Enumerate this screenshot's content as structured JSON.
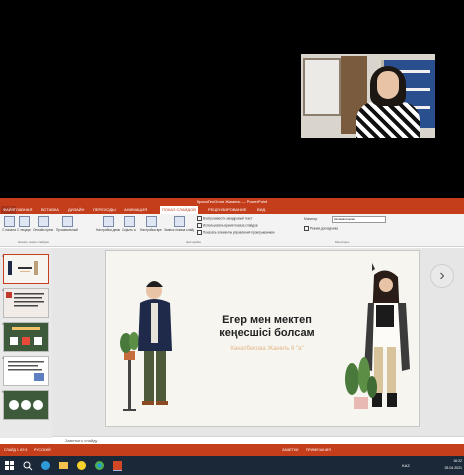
{
  "webcam": {
    "label": ""
  },
  "ppt": {
    "window_title": "КрасиГеоОлли Жамель — PowerPoint",
    "tabs": [
      "ФАЙЛ",
      "ГЛАВНАЯ",
      "ВСТАВКА",
      "ДИЗАЙН",
      "ПЕРЕХОДЫ",
      "АНИМАЦИЯ",
      "ПОКАЗ СЛАЙДОВ",
      "РЕЦЕНЗИРОВАНИЕ",
      "ВИД"
    ],
    "active_tab": "ПОКАЗ СЛАЙДОВ",
    "ribbon": {
      "btn1": "С начала",
      "btn2": "С текущего слайда",
      "btn3": "Онлайн-презентация",
      "btn4": "Произвольный показ",
      "btn5": "Настройка демонстрации",
      "btn6": "Скрыть слайд",
      "btn7": "Настройка времени",
      "btn8": "Запись показа слайдов",
      "grp1": "Начать показ слайдов",
      "grp2": "Настройка",
      "grp3": "Мониторы",
      "chk1": "Воспроизвести закадровый текст",
      "chk2": "Использовать время показа слайдов",
      "chk3": "Показать элементы управления проигрыванием",
      "monitor_label": "Монитор:",
      "monitor_value": "Автоматически",
      "presenter_view": "Режим докладчика"
    },
    "thumb_numbers": [
      "1",
      "2",
      "3",
      "4",
      "5"
    ],
    "slide": {
      "title_line1": "Егер мен мектеп",
      "title_line2": "кеңесшісі болсам",
      "subtitle": "Канатбекова Жанель 8 \"а\""
    },
    "notes_placeholder": "Заметки к слайду",
    "status": {
      "slide_info": "СЛАЙД 1 ИЗ 5",
      "language": "РУССКИЙ",
      "notes_btn": "ЗАМЕТКИ",
      "comments_btn": "ПРИМЕЧАНИЯ"
    }
  },
  "taskbar": {
    "lang": "KAZ",
    "time": "16:22",
    "date": "25.04.2021"
  }
}
